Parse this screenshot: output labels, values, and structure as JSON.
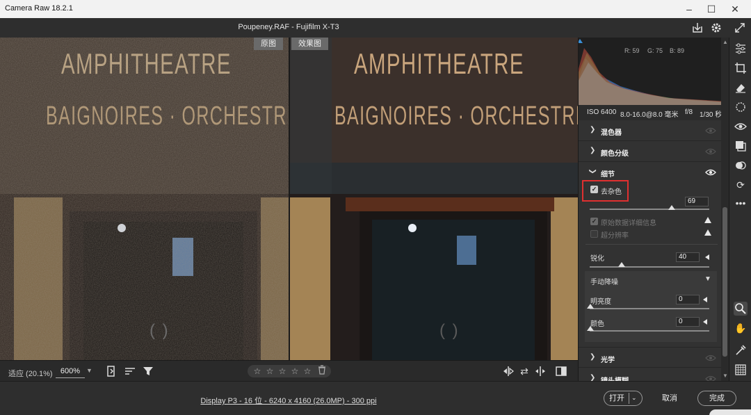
{
  "app": {
    "title": "Camera Raw 18.2.1"
  },
  "header": {
    "file_title": "Poupeney.RAF -  Fujifilm X-T3"
  },
  "canvas": {
    "before_label": "原图",
    "after_label": "效果图",
    "sign_line1": "AMPHITHEATRE",
    "sign_line2": "BAIGNOIRES · ORCHESTRE",
    "sign_line3": "( )"
  },
  "bottombar": {
    "fit_label": "适应 (20.1%)",
    "zoom_value": "600%",
    "rating_stars": [
      "☆",
      "☆",
      "☆",
      "☆",
      "☆"
    ]
  },
  "histogram": {
    "r": "R: 59",
    "g": "G: 75",
    "b": "B: 89"
  },
  "exif": {
    "iso": "ISO 6400",
    "lens": "8.0-16.0@8.0 毫米",
    "aperture": "f/8",
    "shutter": "1/30 秒"
  },
  "panel": {
    "sections": {
      "mixer": "混色器",
      "grading": "颜色分级",
      "detail": "细节",
      "optics": "光学",
      "lens_blur": "镜头模糊"
    },
    "detail": {
      "denoise_label": "去杂色",
      "denoise_value": "69",
      "raw_details_label": "原始数据详细信息",
      "super_res_label": "超分辨率",
      "sharpen_label": "锐化",
      "sharpen_value": "40",
      "manual_nr_label": "手动降噪",
      "luminance_label": "明亮度",
      "luminance_value": "0",
      "color_label": "颜色",
      "color_value": "0"
    }
  },
  "footer": {
    "info": "Display P3 - 16 位 - 6240 x 4160 (26.0MP) - 300 ppi",
    "open_label": "打开",
    "cancel_label": "取消",
    "done_label": "完成"
  },
  "colors": {
    "highlight_box": "#e03030",
    "accent": "#3a8fd6"
  }
}
